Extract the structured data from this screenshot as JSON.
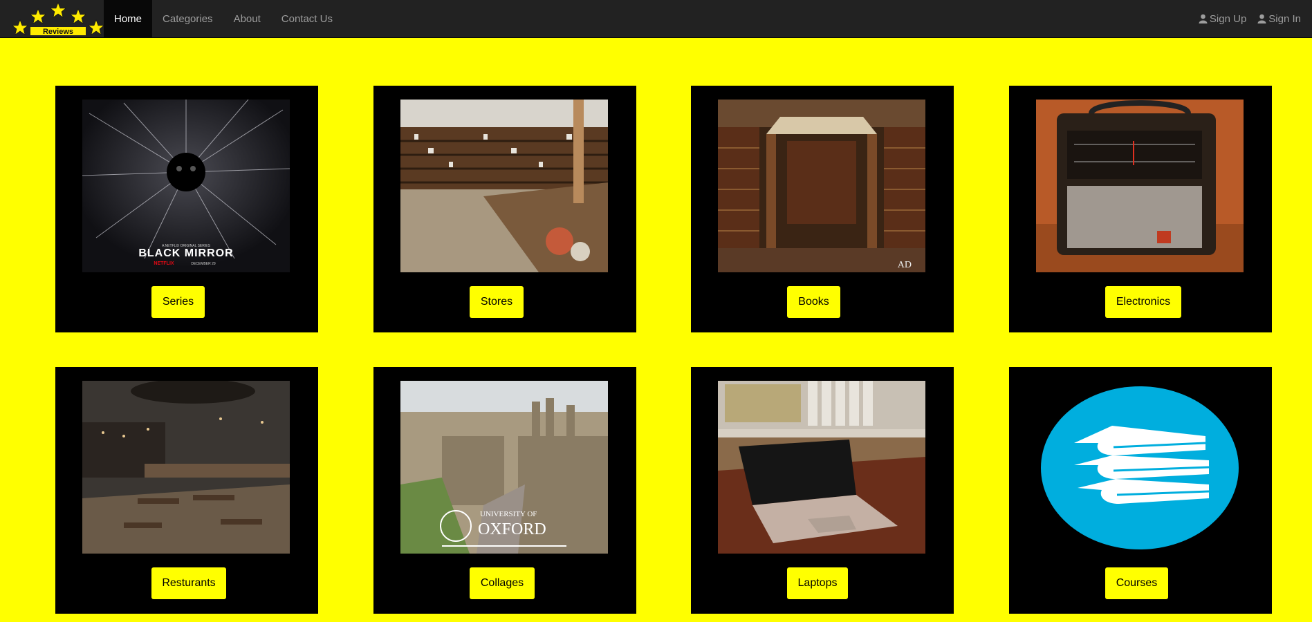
{
  "brand": {
    "logo_text": "Reviews",
    "star_color": "#ffeb00"
  },
  "nav": {
    "home": "Home",
    "categories": "Categories",
    "about": "About",
    "contact": "Contact Us",
    "signup": "Sign Up",
    "signin": "Sign In"
  },
  "colors": {
    "page_bg": "#ffff00",
    "card_bg": "#000000",
    "navbar_bg": "#222222"
  },
  "categories": [
    {
      "label": "Series",
      "image": "black-mirror-poster"
    },
    {
      "label": "Stores",
      "image": "store-interior"
    },
    {
      "label": "Books",
      "image": "library-interior"
    },
    {
      "label": "Electronics",
      "image": "vintage-radio"
    },
    {
      "label": "Resturants",
      "image": "restaurant-interior"
    },
    {
      "label": "Collages",
      "image": "oxford-campus"
    },
    {
      "label": "Laptops",
      "image": "laptop-on-desk"
    },
    {
      "label": "Courses",
      "image": "books-icon"
    }
  ],
  "poster": {
    "title": "BLACK MIRROR",
    "top_line": "A NETFLIX ORIGINAL SERIES",
    "network": "NETFLIX",
    "date_line": "DECEMBER 29"
  },
  "books_image_mark": "AD",
  "oxford": {
    "line1": "UNIVERSITY OF",
    "line2": "OXFORD"
  }
}
